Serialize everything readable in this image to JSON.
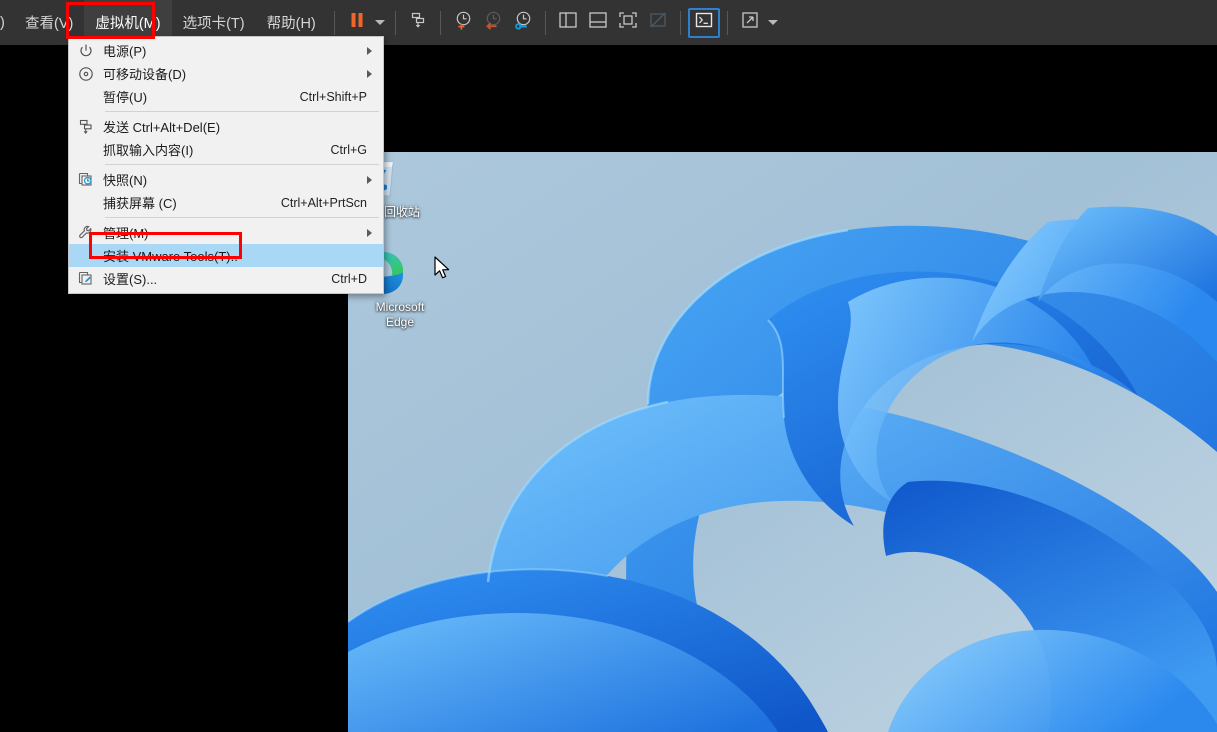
{
  "app": {
    "accent_orange": "#f0662a",
    "accent_blue": "#2f7fd0",
    "menubar_bg": "#333333",
    "highlight_red": "#ff0000",
    "menu_bg": "#f1f1f1",
    "menu_selected_bg": "#a8d8f5"
  },
  "menubar": {
    "items": [
      {
        "label": ")",
        "name": "menu-truncated",
        "active": false
      },
      {
        "label": "查看(V)",
        "name": "menu-view",
        "active": false
      },
      {
        "label": "虚拟机(M)",
        "name": "menu-vm",
        "active": true
      },
      {
        "label": "选项卡(T)",
        "name": "menu-tabs",
        "active": false
      },
      {
        "label": "帮助(H)",
        "name": "menu-help",
        "active": false
      }
    ],
    "toolbar": [
      {
        "name": "pause-button",
        "icon": "pause-icon",
        "label": "暂停"
      },
      {
        "name": "power-dropdown-caret",
        "icon": "chevron-down-icon",
        "label": ""
      },
      {
        "name": "send-ctrl-alt-del-button",
        "icon": "send-keys-icon",
        "label": "发送 Ctrl+Alt+Del"
      },
      {
        "name": "take-snapshot-button",
        "icon": "snapshot-add-icon",
        "label": "拍摄此虚拟机的快照"
      },
      {
        "name": "revert-snapshot-button",
        "icon": "snapshot-revert-icon",
        "label": "恢复到快照"
      },
      {
        "name": "snapshot-manager-button",
        "icon": "snapshot-manager-icon",
        "label": "管理快照"
      },
      {
        "name": "show-library-button",
        "icon": "panel-left-icon",
        "label": "显示或隐藏库"
      },
      {
        "name": "show-thumbnail-bar-button",
        "icon": "panel-bottom-icon",
        "label": "显示或隐藏缩略图栏"
      },
      {
        "name": "fullscreen-button",
        "icon": "fullscreen-icon",
        "label": "进入全屏模式"
      },
      {
        "name": "unity-mode-button",
        "icon": "unity-mode-icon",
        "label": "Unity 模式",
        "disabled": true
      },
      {
        "name": "console-button",
        "icon": "terminal-icon",
        "label": "控制台",
        "focused": true
      },
      {
        "name": "stretch-button",
        "icon": "expand-arrows-icon",
        "label": "自由拉伸"
      },
      {
        "name": "stretch-dropdown-caret",
        "icon": "chevron-down-icon",
        "label": ""
      }
    ]
  },
  "dropdown": {
    "name": "vm-menu-dropdown",
    "groups": [
      {
        "items": [
          {
            "label": "电源(P)",
            "icon": "power-icon",
            "accel": "",
            "submenu": true,
            "selected": false,
            "name": "menu-item-power"
          },
          {
            "label": "可移动设备(D)",
            "icon": "removable-device-icon",
            "accel": "",
            "submenu": true,
            "selected": false,
            "name": "menu-item-removable-devices"
          },
          {
            "label": "暂停(U)",
            "icon": "",
            "accel": "Ctrl+Shift+P",
            "submenu": false,
            "selected": false,
            "name": "menu-item-pause"
          }
        ]
      },
      {
        "items": [
          {
            "label": "发送 Ctrl+Alt+Del(E)",
            "icon": "send-keys-icon",
            "accel": "",
            "submenu": false,
            "selected": false,
            "name": "menu-item-send-ctrl-alt-del"
          },
          {
            "label": "抓取输入内容(I)",
            "icon": "",
            "accel": "Ctrl+G",
            "submenu": false,
            "selected": false,
            "name": "menu-item-grab-input"
          }
        ]
      },
      {
        "items": [
          {
            "label": "快照(N)",
            "icon": "snapshot-icon",
            "accel": "",
            "submenu": true,
            "selected": false,
            "name": "menu-item-snapshot"
          },
          {
            "label": "捕获屏幕 (C)",
            "icon": "",
            "accel": "Ctrl+Alt+PrtScn",
            "submenu": false,
            "selected": false,
            "name": "menu-item-capture-screen"
          }
        ]
      },
      {
        "items": [
          {
            "label": "管理(M)",
            "icon": "wrench-icon",
            "accel": "",
            "submenu": true,
            "selected": false,
            "name": "menu-item-manage"
          },
          {
            "label": "安装 VMware Tools(T)..",
            "icon": "",
            "accel": "",
            "submenu": false,
            "selected": true,
            "name": "menu-item-install-vmware-tools"
          },
          {
            "label": "设置(S)...",
            "icon": "settings-icon",
            "accel": "Ctrl+D",
            "submenu": false,
            "selected": false,
            "name": "menu-item-settings"
          }
        ]
      }
    ]
  },
  "desktop": {
    "icons": [
      {
        "label": "回收站",
        "name": "desktop-icon-recycle-bin",
        "icon": "recycle-bin-icon"
      },
      {
        "label": "Microsoft\nEdge",
        "label_line1": "Microsoft",
        "label_line2": "Edge",
        "name": "desktop-icon-microsoft-edge",
        "icon": "edge-icon"
      }
    ]
  },
  "annotations": [
    {
      "name": "vm-menu-highlight",
      "target": "虚拟机(M)",
      "color": "#ff0000"
    },
    {
      "name": "install-vmware-tools-highlight",
      "target": "安装 VMware Tools(T)..",
      "color": "#ff0000"
    }
  ]
}
